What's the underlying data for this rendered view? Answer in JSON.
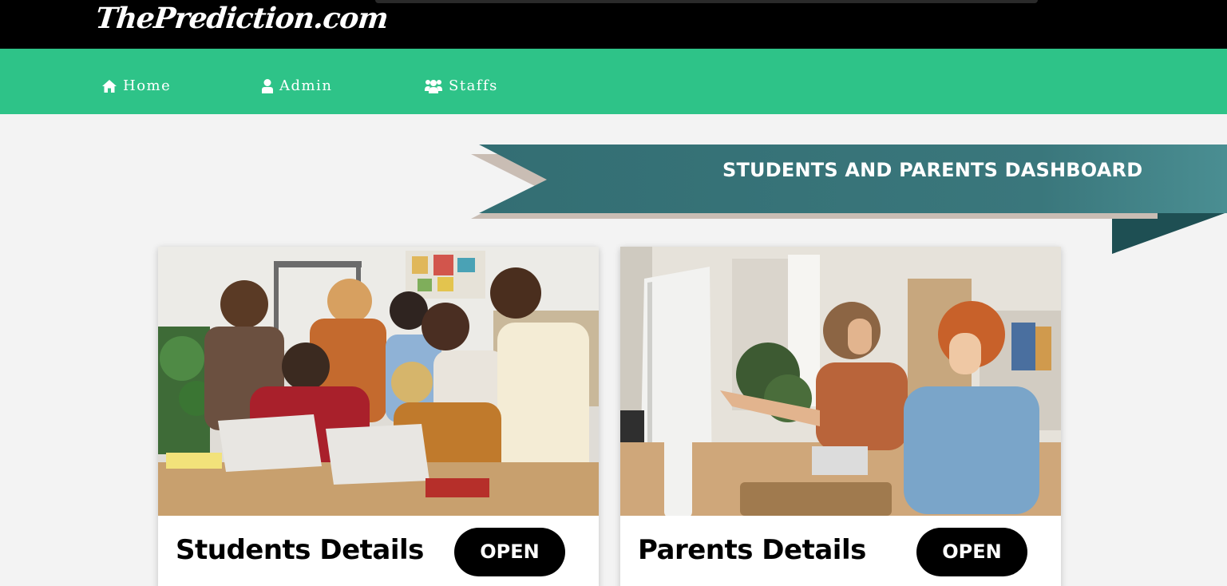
{
  "header": {
    "logo": "ThePrediction.com"
  },
  "nav": {
    "items": [
      {
        "label": "Home",
        "icon": "home-icon"
      },
      {
        "label": "Admin",
        "icon": "user-icon"
      },
      {
        "label": "Staffs",
        "icon": "users-icon"
      }
    ]
  },
  "banner": {
    "title": "STUDENTS AND PARENTS DASHBOARD"
  },
  "cards": [
    {
      "title": "Students Details",
      "button": "OPEN",
      "image": "students-photo"
    },
    {
      "title": "Parents Details",
      "button": "OPEN",
      "image": "parents-photo"
    }
  ],
  "colors": {
    "topbar": "#000000",
    "navbar": "#2ec388",
    "ribbon": "#3d7a7e",
    "button": "#000000",
    "background": "#f3f3f3"
  }
}
